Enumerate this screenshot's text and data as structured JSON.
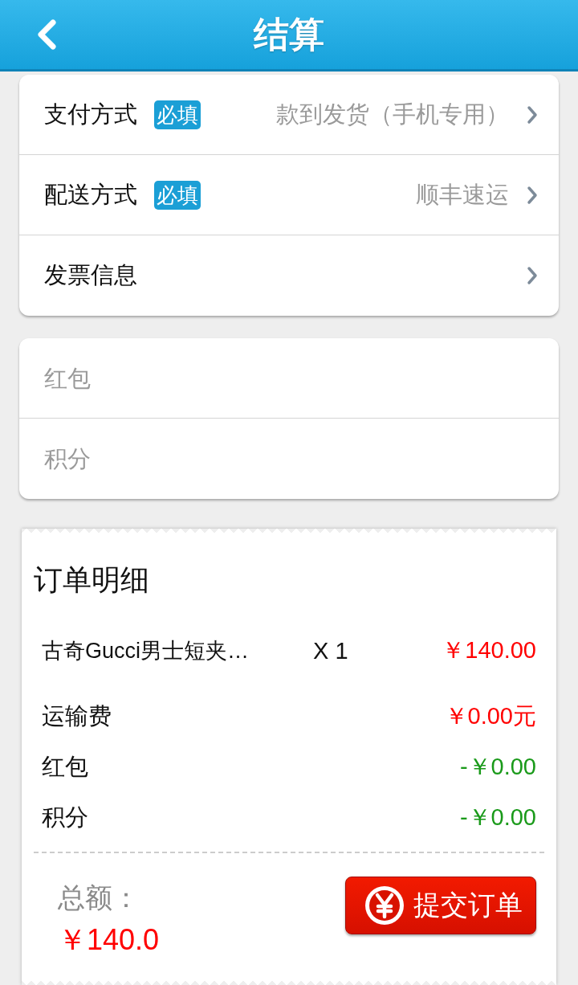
{
  "header": {
    "title": "结算"
  },
  "checkout_options": [
    {
      "label": "支付方式",
      "required_tag": "必填",
      "value": "款到发货（手机专用）"
    },
    {
      "label": "配送方式",
      "required_tag": "必填",
      "value": "顺丰速运"
    },
    {
      "label": "发票信息"
    }
  ],
  "discount_fields": [
    {
      "placeholder": "红包"
    },
    {
      "placeholder": "积分"
    }
  ],
  "order_details": {
    "title": "订单明细",
    "items": [
      {
        "name": "古奇Gucci男士短夹…",
        "quantity": "X 1",
        "price": "￥140.00"
      }
    ],
    "charges": [
      {
        "label": "运输费",
        "amount": "￥0.00元",
        "color": "#ff0000"
      },
      {
        "label": "红包",
        "amount": "-￥0.00",
        "color": "#1a9a1a"
      },
      {
        "label": "积分",
        "amount": "-￥0.00",
        "color": "#1a9a1a"
      }
    ]
  },
  "total": {
    "label": "总额：",
    "amount": "￥140.0"
  },
  "submit_button": {
    "label": "提交订单"
  }
}
